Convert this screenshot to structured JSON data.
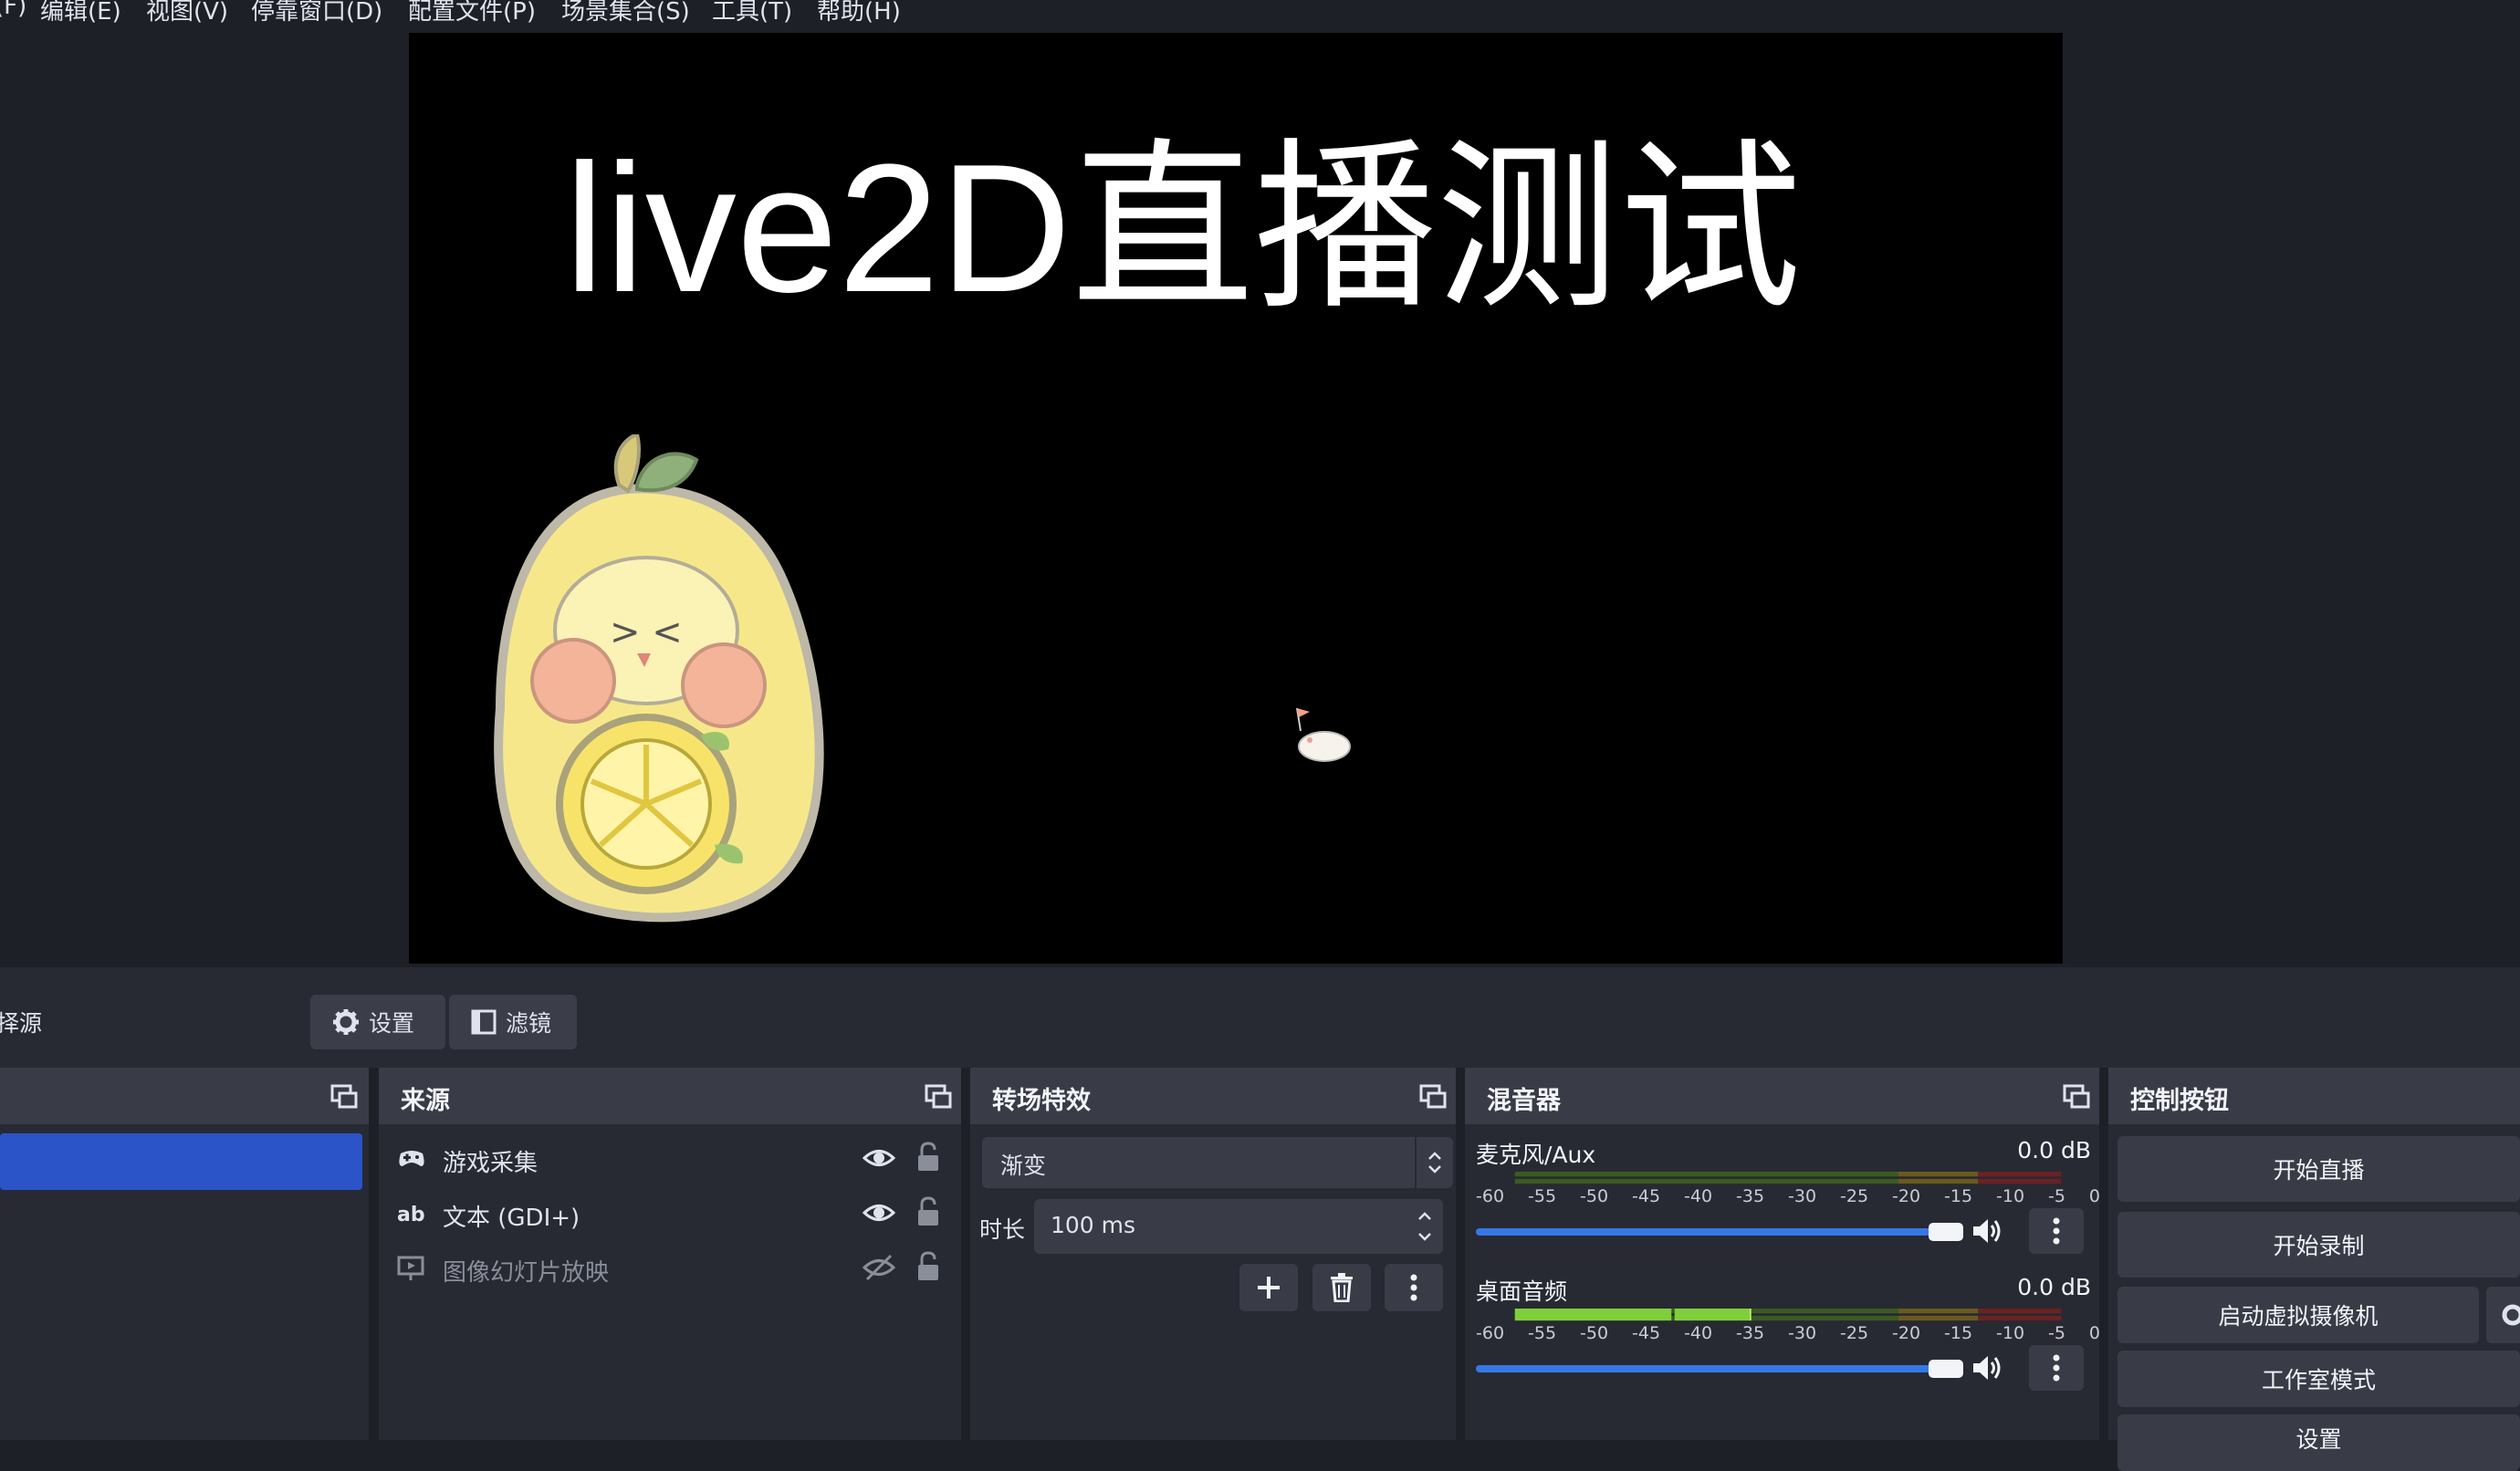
{
  "menu": [
    "(F)",
    "编辑(E)",
    "视图(V)",
    "停靠窗口(D)",
    "配置文件(P)",
    "场景集合(S)",
    "工具(T)",
    "帮助(H)"
  ],
  "preview": {
    "title_text": "live2D直播测试"
  },
  "toolbar": {
    "left_label": "择源",
    "settings_label": "设置",
    "filters_label": "滤镜"
  },
  "sources": {
    "title": "来源",
    "items": [
      {
        "label": "游戏采集",
        "icon": "gamepad-icon",
        "visible": true
      },
      {
        "label": "文本 (GDI+)",
        "icon": "text-icon",
        "visible": true
      },
      {
        "label": "图像幻灯片放映",
        "icon": "slideshow-icon",
        "visible": false
      }
    ]
  },
  "transitions": {
    "title": "转场特效",
    "selected": "渐变",
    "duration_label": "时长",
    "duration_value": "100 ms"
  },
  "mixer": {
    "title": "混音器",
    "scale": [
      "-60",
      "-55",
      "-50",
      "-45",
      "-40",
      "-35",
      "-30",
      "-25",
      "-20",
      "-15",
      "-10",
      "-5",
      "0"
    ],
    "channels": [
      {
        "name": "麦克风/Aux",
        "db": "0.0 dB",
        "volume": 0.95
      },
      {
        "name": "桌面音频",
        "db": "0.0 dB",
        "volume": 0.95
      }
    ]
  },
  "controls": {
    "title": "控制按钮",
    "start_stream": "开始直播",
    "start_record": "开始录制",
    "virtual_cam": "启动虚拟摄像机",
    "studio_mode": "工作室模式",
    "settings": "设置"
  },
  "colors": {
    "accent": "#3578e5",
    "selected_scene": "#2b54c9",
    "panel": "#272a33",
    "header": "#393c47"
  }
}
